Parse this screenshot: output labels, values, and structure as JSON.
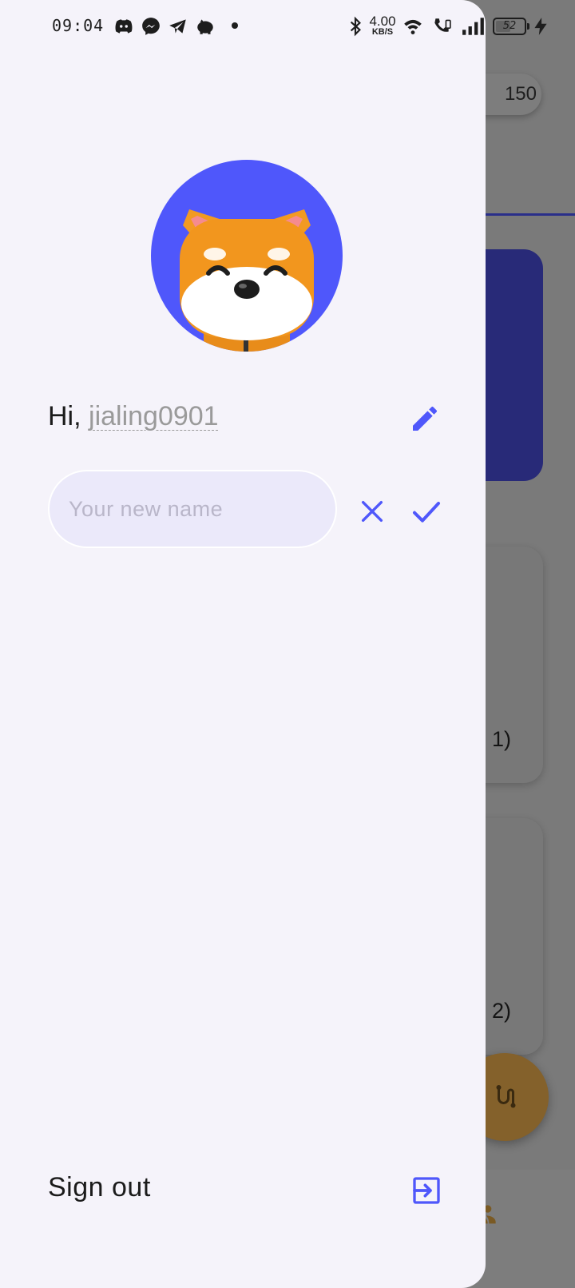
{
  "status_bar": {
    "time": "09:04",
    "net_speed_value": "4.00",
    "net_speed_unit": "KB/S",
    "battery_level": "52",
    "notification_icons": [
      "discord-icon",
      "messenger-icon",
      "telegram-icon",
      "piggy-bank-icon",
      "more-dot-icon"
    ],
    "system_icons": [
      "bluetooth-icon",
      "wifi-icon",
      "wifi-calling-icon",
      "signal-icon",
      "battery-icon",
      "charging-icon"
    ]
  },
  "background_app": {
    "points_value": "150",
    "card1_label_fragment": "1)",
    "card2_label_fragment": ": 2)"
  },
  "drawer": {
    "avatar": {
      "description_icon": "shiba-dog-avatar",
      "background_color": "#4f57fb"
    },
    "greeting_prefix": "Hi,",
    "username": "jialing0901",
    "name_input": {
      "placeholder": "Your new name",
      "value": ""
    },
    "sign_out_label": "Sign out"
  },
  "colors": {
    "accent": "#4f57fb",
    "drawer_bg": "#f5f3fa",
    "input_bg": "#ebe9fa",
    "scrim": "#7a7a7a",
    "fab": "#84612b"
  }
}
